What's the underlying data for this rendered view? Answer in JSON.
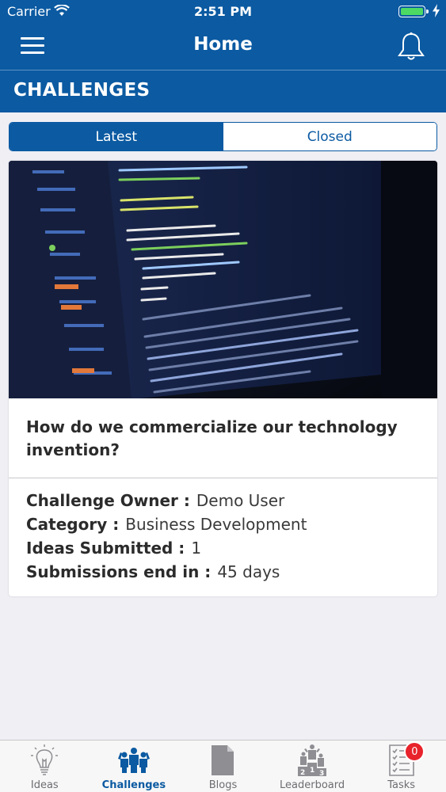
{
  "status_bar": {
    "carrier": "Carrier",
    "time": "2:51 PM",
    "battery_color": "#4cd964"
  },
  "nav": {
    "title": "Home",
    "menu_icon": "hamburger-menu-icon",
    "right_icon": "bell-icon"
  },
  "section": {
    "title": "CHALLENGES"
  },
  "segments": {
    "items": [
      {
        "label": "Latest",
        "selected": true
      },
      {
        "label": "Closed",
        "selected": false
      }
    ]
  },
  "challenge": {
    "image": "laptop-code-photo",
    "title": "How do we commercialize our technology invention?",
    "details": [
      {
        "label": "Challenge Owner :",
        "value": "Demo User"
      },
      {
        "label": "Category :",
        "value": "Business Development"
      },
      {
        "label": "Ideas Submitted :",
        "value": "1"
      },
      {
        "label": "Submissions end in :",
        "value": "45 days"
      }
    ]
  },
  "tabbar": {
    "items": [
      {
        "label": "Ideas",
        "icon": "lightbulb-icon",
        "active": false
      },
      {
        "label": "Challenges",
        "icon": "people-group-icon",
        "active": true
      },
      {
        "label": "Blogs",
        "icon": "document-icon",
        "active": false
      },
      {
        "label": "Leaderboard",
        "icon": "podium-icon",
        "active": false
      },
      {
        "label": "Tasks",
        "icon": "checklist-icon",
        "active": false,
        "badge": "0"
      }
    ]
  },
  "colors": {
    "primary": "#0b5aa2",
    "badge": "#e8232b",
    "background": "#efeff4"
  }
}
